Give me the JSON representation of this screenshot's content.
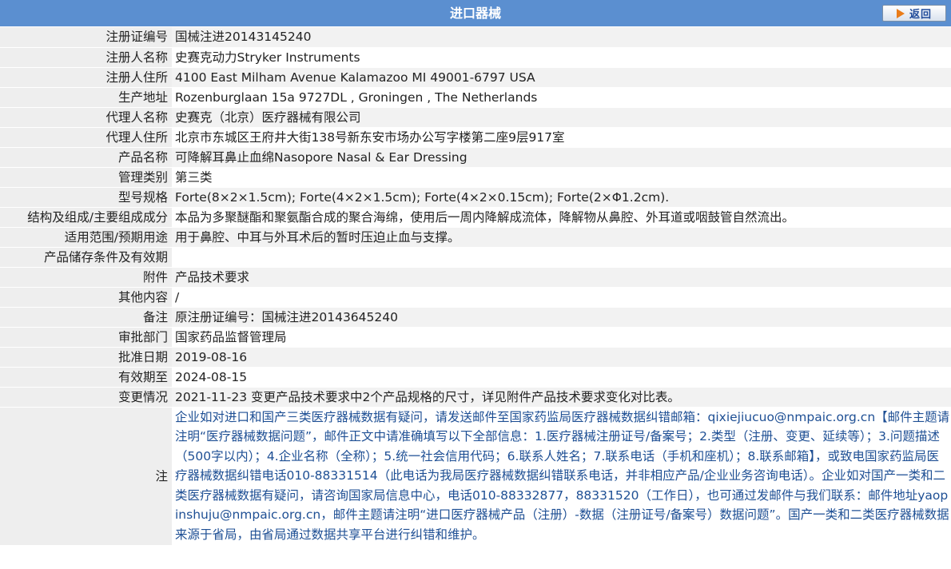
{
  "header": {
    "title": "进口器械",
    "back_label": "返回"
  },
  "rows": [
    {
      "label": "注册证编号",
      "value": "国械注进20143145240"
    },
    {
      "label": "注册人名称",
      "value": "史赛克动力Stryker Instruments"
    },
    {
      "label": "注册人住所",
      "value": "4100 East Milham Avenue Kalamazoo MI 49001-6797 USA"
    },
    {
      "label": "生产地址",
      "value": "Rozenburglaan 15a 9727DL , Groningen , The Netherlands"
    },
    {
      "label": "代理人名称",
      "value": "史赛克（北京）医疗器械有限公司"
    },
    {
      "label": "代理人住所",
      "value": "北京市东城区王府井大街138号新东安市场办公写字楼第二座9层917室"
    },
    {
      "label": "产品名称",
      "value": "可降解耳鼻止血绵Nasopore Nasal & Ear Dressing"
    },
    {
      "label": "管理类别",
      "value": "第三类"
    },
    {
      "label": "型号规格",
      "value": "Forte(8×2×1.5cm); Forte(4×2×1.5cm); Forte(4×2×0.15cm); Forte(2×Φ1.2cm)."
    },
    {
      "label": "结构及组成/主要组成成分",
      "value": "本品为多聚醚酯和聚氨酯合成的聚合海绵，使用后一周内降解成流体，降解物从鼻腔、外耳道或咽鼓管自然流出。"
    },
    {
      "label": "适用范围/预期用途",
      "value": "用于鼻腔、中耳与外耳术后的暂时压迫止血与支撑。"
    },
    {
      "label": "产品储存条件及有效期",
      "value": ""
    },
    {
      "label": "附件",
      "value": "产品技术要求"
    },
    {
      "label": "其他内容",
      "value": "/"
    },
    {
      "label": "备注",
      "value": "原注册证编号：国械注进20143645240"
    },
    {
      "label": "审批部门",
      "value": "国家药品监督管理局"
    },
    {
      "label": "批准日期",
      "value": "2019-08-16"
    },
    {
      "label": "有效期至",
      "value": "2024-08-15"
    },
    {
      "label": "变更情况",
      "value": "2021-11-23 变更产品技术要求中2个产品规格的尺寸，详见附件产品技术要求变化对比表。"
    }
  ],
  "note": {
    "label": "注",
    "text": "企业如对进口和国产三类医疗器械数据有疑问，请发送邮件至国家药监局医疗器械数据纠错邮箱：qixiejiucuo@nmpaic.org.cn【邮件主题请注明“医疗器械数据问题”，邮件正文中请准确填写以下全部信息：1.医疗器械注册证号/备案号；2.类型（注册、变更、延续等）；3.问题描述（500字以内）；4.企业名称（全称）；5.统一社会信用代码；6.联系人姓名；7.联系电话（手机和座机）；8.联系邮箱】，或致电国家药监局医疗器械数据纠错电话010-88331514（此电话为我局医疗器械数据纠错联系电话，并非相应产品/企业业务咨询电话）。企业如对国产一类和二类医疗器械数据有疑问，请咨询国家局信息中心，电话010-88332877，88331520（工作日），也可通过发邮件与我们联系：邮件地址yaopinshuju@nmpaic.org.cn，邮件主题请注明“进口医疗器械产品（注册）-数据（注册证号/备案号）数据问题”。国产一类和二类医疗器械数据来源于省局，由省局通过数据共享平台进行纠错和维护。"
  }
}
